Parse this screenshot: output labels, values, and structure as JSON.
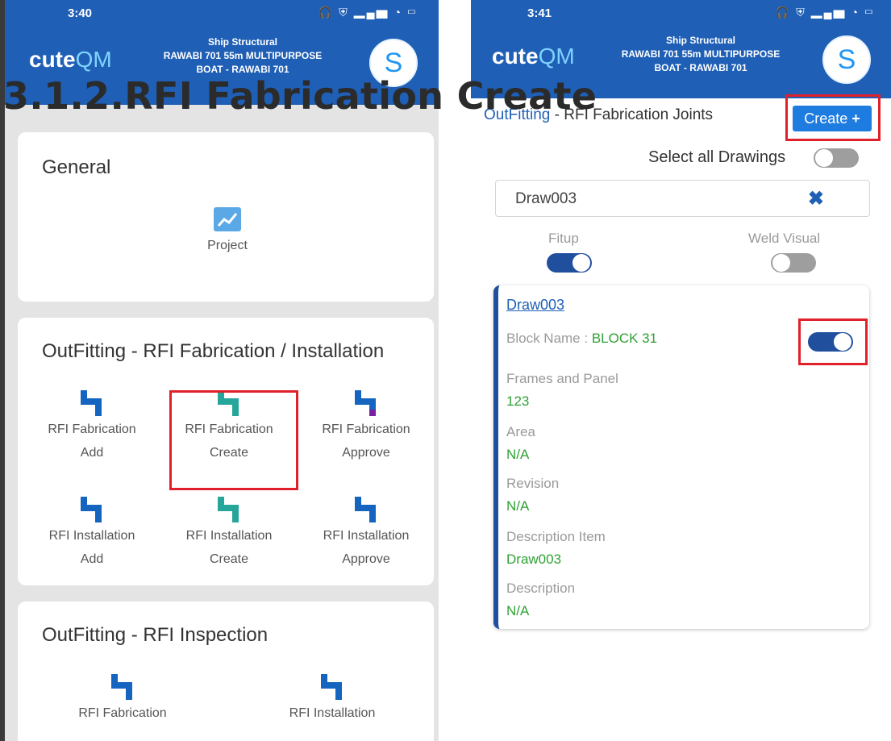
{
  "left_phone": {
    "status": {
      "time": "3:40",
      "signal_text": "4G",
      "system_icons": "headphones, shield, signal, wifi, battery"
    },
    "appbar": {
      "logo_a": "cute",
      "logo_b": "QM",
      "ship_line1": "Ship Structural",
      "ship_line2": "RAWABI 701 55m MULTIPURPOSE",
      "ship_line3": "BOAT - RAWABI 701",
      "avatar_letter": "S"
    },
    "general": {
      "title": "General",
      "project_label": "Project"
    },
    "rfi_fab_install": {
      "title": "OutFitting - RFI Fabrication / Installation",
      "tiles": [
        {
          "line1": "RFI Fabrication",
          "line2": "Add",
          "color": "#1565c0"
        },
        {
          "line1": "RFI Fabrication",
          "line2": "Create",
          "color": "#26a69a"
        },
        {
          "line1": "RFI Fabrication",
          "line2": "Approve",
          "color": "#7b1fa2"
        },
        {
          "line1": "RFI Installation",
          "line2": "Add",
          "color": "#1565c0"
        },
        {
          "line1": "RFI Installation",
          "line2": "Create",
          "color": "#26a69a"
        },
        {
          "line1": "RFI Installation",
          "line2": "Approve",
          "color": "#1565c0"
        }
      ]
    },
    "rfi_inspection": {
      "title": "OutFitting - RFI Inspection",
      "tiles": [
        {
          "label": "RFI Fabrication"
        },
        {
          "label": "RFI Installation"
        }
      ]
    }
  },
  "overlay_title": "3.1.2.RFI Fabrication Create",
  "right_phone": {
    "status": {
      "time": "3:41"
    },
    "appbar": {
      "logo_a": "cute",
      "logo_b": "QM",
      "ship_line1": "Ship Structural",
      "ship_line2": "RAWABI 701 55m MULTIPURPOSE",
      "ship_line3": "BOAT - RAWABI 701",
      "avatar_letter": "S"
    },
    "header": {
      "accent": "OutFitting",
      "rest": " - RFI Fabrication Joints"
    },
    "create_button": "Create",
    "select_all_label": "Select all Drawings",
    "search_value": "Draw003",
    "fitup_label": "Fitup",
    "weld_visual_label": "Weld Visual",
    "fitup_on": true,
    "weld_visual_on": false,
    "select_all_on": false,
    "drawing": {
      "name": "Draw003",
      "block_label": "Block Name : ",
      "block_value": "BLOCK 31",
      "frames_label": "Frames and Panel",
      "frames_value": "123",
      "area_label": "Area",
      "area_value": "N/A",
      "revision_label": "Revision",
      "revision_value": "N/A",
      "desc_item_label": "Description Item",
      "desc_item_value": "Draw003",
      "desc_label": "Description",
      "desc_value": "N/A",
      "selected": true
    }
  },
  "colors": {
    "app_bar": "#1f5fb5",
    "create_button": "#1e7be0",
    "highlight": "#e0202a",
    "value_green": "#2ea133"
  }
}
